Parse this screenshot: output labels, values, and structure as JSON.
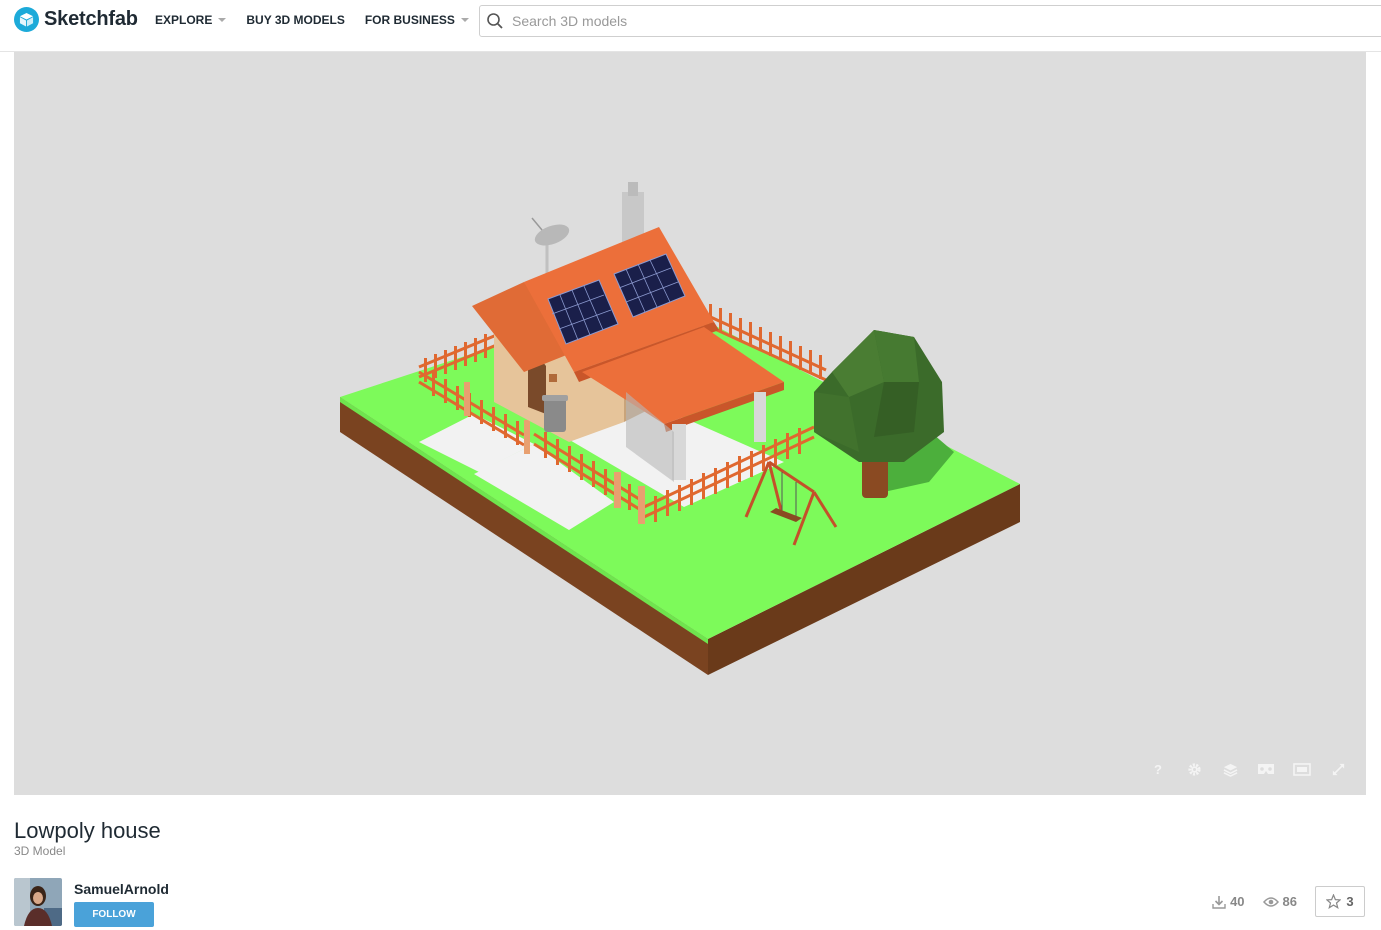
{
  "brand": {
    "name": "Sketchfab"
  },
  "nav": {
    "explore": "EXPLORE",
    "buy_models": "BUY 3D MODELS",
    "for_business": "FOR BUSINESS"
  },
  "search": {
    "placeholder": "Search 3D models",
    "value": ""
  },
  "viewer": {
    "help_label": "?",
    "controls": [
      "help-icon",
      "gear-icon",
      "layers-icon",
      "vr-icon",
      "theatre-mode-icon",
      "fullscreen-icon"
    ]
  },
  "model": {
    "title": "Lowpoly house",
    "type": "3D Model"
  },
  "author": {
    "name": "SamuelArnold",
    "follow_label": "FOLLOW"
  },
  "stats": {
    "downloads": "40",
    "views": "86",
    "likes": "3"
  },
  "colors": {
    "brand": "#1caad9",
    "follow": "#4aa2d9",
    "viewer_bg": "#dddddd",
    "grass": "#7dfa5a",
    "soil": "#7a4320",
    "roof": "#ec6f3a",
    "fence": "#e0682f"
  }
}
